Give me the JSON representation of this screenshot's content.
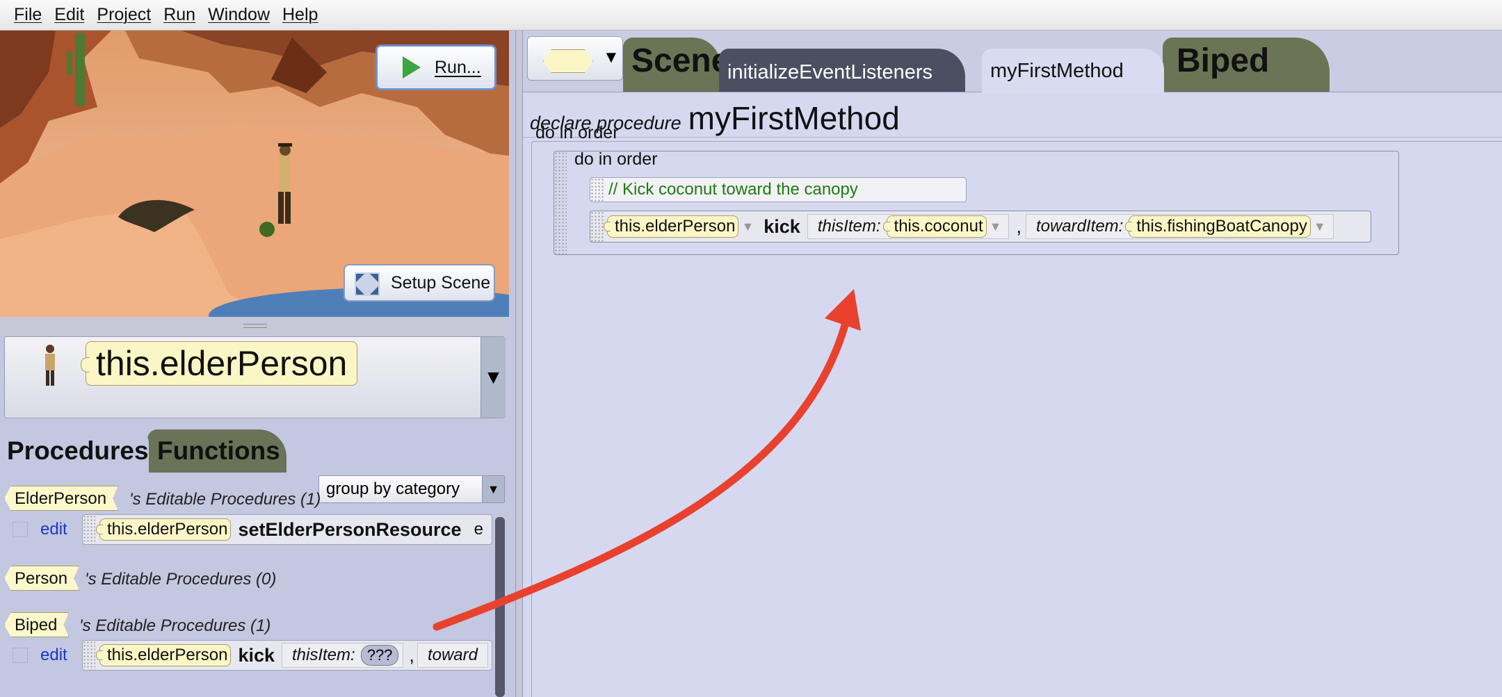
{
  "menu": [
    "File",
    "Edit",
    "Project",
    "Run",
    "Window",
    "Help"
  ],
  "scene": {
    "run_label": "Run...",
    "setup_label": "Setup Scene"
  },
  "instance_selector": {
    "value": "this.elderPerson"
  },
  "left_tabs": {
    "procedures": "Procedures",
    "functions": "Functions"
  },
  "group_select": {
    "value": "group by category"
  },
  "sections": [
    {
      "type": "ElderPerson",
      "title": "'s Editable Procedures (1)"
    },
    {
      "type": "Person",
      "title": "'s Editable Procedures (0)"
    },
    {
      "type": "Biped",
      "title": "'s Editable Procedures (1)"
    }
  ],
  "edit_label": "edit",
  "proc_rows": [
    {
      "target": "this.elderPerson",
      "method": "setElderPersonResource",
      "trail": "e"
    },
    {
      "target": "this.elderPerson",
      "method": "kick",
      "param1": "thisItem:",
      "value1": "???",
      "sep": ",",
      "param2": "toward"
    }
  ],
  "right_tabs": {
    "scene": "Scene",
    "init": "initializeEventListeners",
    "my": "myFirstMethod",
    "biped": "Biped"
  },
  "code": {
    "declare_label": "declare procedure",
    "declare_name": "myFirstMethod",
    "outer_do": "do in order",
    "inner_do": "do in order",
    "comment": "// Kick coconut toward the canopy",
    "kick": {
      "target": "this.elderPerson",
      "method": "kick",
      "param1": "thisItem:",
      "value1": "this.coconut",
      "sep": ",",
      "param2": "towardItem:",
      "value2": "this.fishingBoatCanopy"
    }
  },
  "colors": {
    "annotation_arrow": "#e8412e",
    "chip_fill": "#fbf6c6",
    "comment_text": "#1f7a12",
    "edit_link": "#1c37c4"
  },
  "icons": {
    "run": "play-icon",
    "setup": "expand-icon",
    "dropdown": "chevron-down-icon"
  }
}
